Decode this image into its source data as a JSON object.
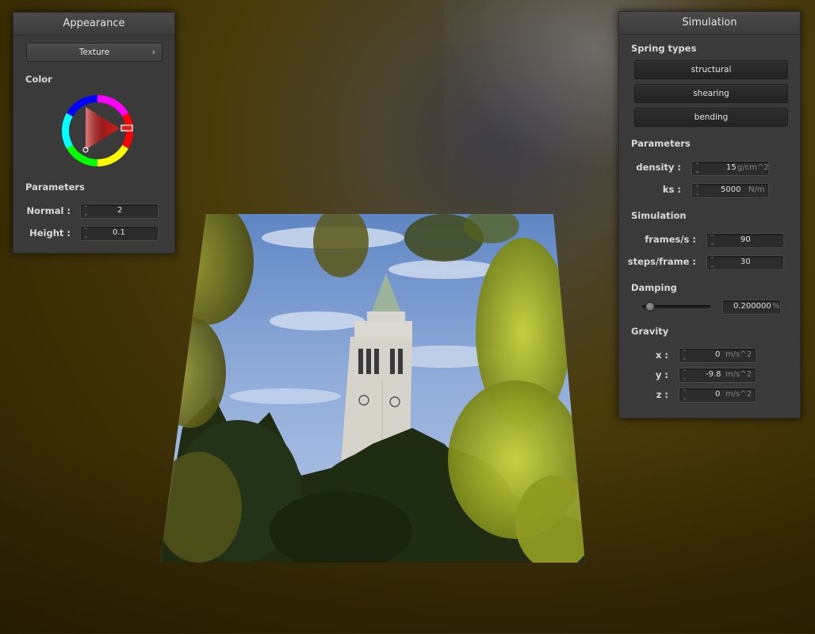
{
  "appearance": {
    "title": "Appearance",
    "texture_button": "Texture",
    "color_label": "Color",
    "parameters_label": "Parameters",
    "normal_label": "Normal :",
    "normal_value": "2",
    "height_label": "Height :",
    "height_value": "0.1"
  },
  "simulation": {
    "title": "Simulation",
    "spring_types_label": "Spring types",
    "spring_buttons": [
      "structural",
      "shearing",
      "bending"
    ],
    "parameters_label": "Parameters",
    "density_label": "density :",
    "density_value": "15",
    "density_unit": "g/cm^2",
    "ks_label": "ks :",
    "ks_value": "5000",
    "ks_unit": "N/m",
    "simulation_label": "Simulation",
    "fps_label": "frames/s :",
    "fps_value": "90",
    "steps_label": "steps/frame :",
    "steps_value": "30",
    "damping_label": "Damping",
    "damping_value": "0.200000",
    "damping_unit": "%",
    "damping_fraction": 0.2,
    "gravity_label": "Gravity",
    "gx_label": "x :",
    "gx_value": "0",
    "gy_label": "y :",
    "gy_value": "-9.8",
    "gz_label": "z :",
    "gz_value": "0",
    "gravity_unit": "m/s^2"
  },
  "colors": {
    "panel_bg": "#3a3a3a",
    "selected_color": "#e02020"
  }
}
